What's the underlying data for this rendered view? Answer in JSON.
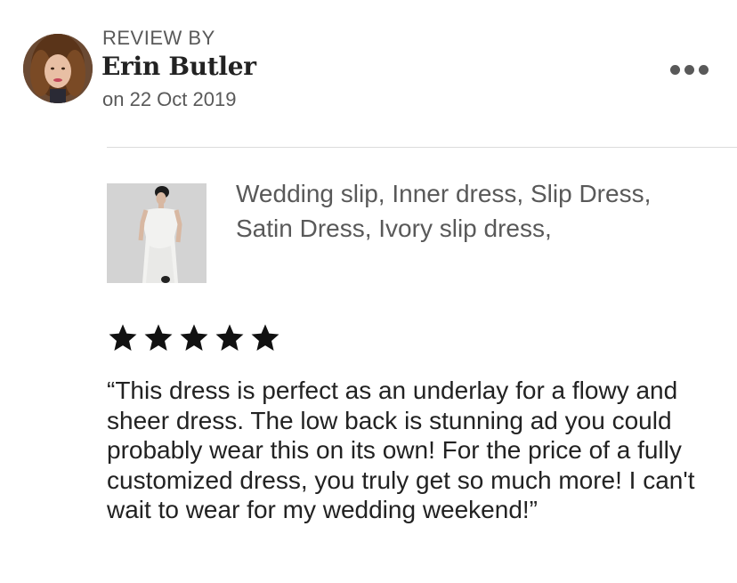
{
  "reviewer": {
    "review_by_label": "REVIEW BY",
    "name": "Erin Butler",
    "date": "on 22 Oct 2019"
  },
  "actions": {
    "more_icon": "more-horizontal-icon"
  },
  "product": {
    "title": "Wedding slip, Inner dress, Slip Dress, Satin Dress, Ivory slip dress,"
  },
  "rating": {
    "value": 5,
    "max": 5,
    "star_color": "#111111"
  },
  "review": {
    "text": "“This dress is perfect as an underlay for a flowy and sheer dress. The low back is stunning ad you could probably wear this on its own! For the price of a fully customized dress, you truly get so much more! I can't wait to wear for my wedding weekend!”"
  }
}
